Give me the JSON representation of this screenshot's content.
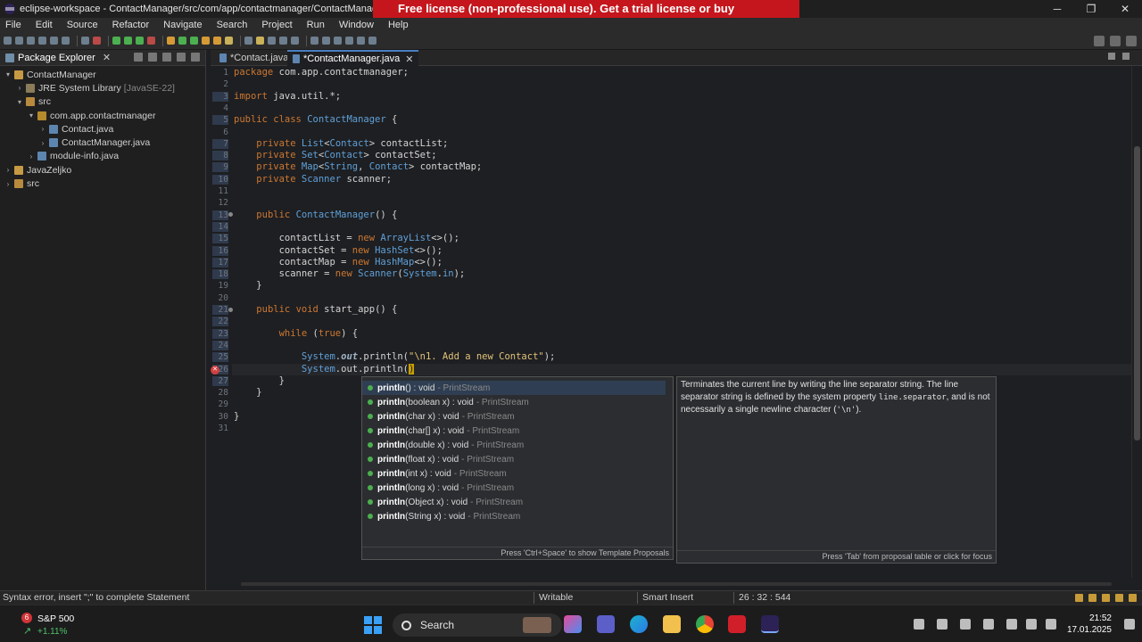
{
  "window": {
    "title": "eclipse-workspace - ContactManager/src/com/app/contactmanager/ContactManager.java - Eclipse IDE",
    "banner": "Free license (non-professional use). Get a trial license or buy",
    "minimize": "─",
    "maximize": "❐",
    "close": "✕"
  },
  "menu": [
    "File",
    "Edit",
    "Source",
    "Refactor",
    "Navigate",
    "Search",
    "Project",
    "Run",
    "Window",
    "Help"
  ],
  "package_explorer": {
    "title": "Package Explorer",
    "close": "✕",
    "tree": [
      {
        "label": "ContactManager",
        "extra": "",
        "icon": "project-icon",
        "depth": 0,
        "twisty": "▾"
      },
      {
        "label": "JRE System Library",
        "extra": "[JavaSE-22]",
        "icon": "library-icon",
        "depth": 1,
        "twisty": "›"
      },
      {
        "label": "src",
        "extra": "",
        "icon": "source-folder-icon",
        "depth": 1,
        "twisty": "▾"
      },
      {
        "label": "com.app.contactmanager",
        "extra": "",
        "icon": "package-icon",
        "depth": 2,
        "twisty": "▾"
      },
      {
        "label": "Contact.java",
        "extra": "",
        "icon": "java-file-icon",
        "depth": 3,
        "twisty": "›"
      },
      {
        "label": "ContactManager.java",
        "extra": "",
        "icon": "java-file-icon",
        "depth": 3,
        "twisty": "›"
      },
      {
        "label": "module-info.java",
        "extra": "",
        "icon": "java-file-icon",
        "depth": 2,
        "twisty": "›"
      },
      {
        "label": "JavaZeljko",
        "extra": "",
        "icon": "project-icon",
        "depth": 0,
        "twisty": "›"
      },
      {
        "label": "src",
        "extra": "",
        "icon": "source-folder-icon",
        "depth": 0,
        "twisty": "›"
      }
    ]
  },
  "editor": {
    "tabs": [
      {
        "label": "*Contact.java",
        "active": false
      },
      {
        "label": "*ContactManager.java",
        "active": true
      }
    ],
    "tab_close": "✕",
    "lines": [
      {
        "n": "1",
        "code": "package com.app.contactmanager;"
      },
      {
        "n": "2",
        "code": ""
      },
      {
        "n": "3",
        "code": "import java.util.*;"
      },
      {
        "n": "4",
        "code": ""
      },
      {
        "n": "5",
        "code": "public class ContactManager {"
      },
      {
        "n": "6",
        "code": ""
      },
      {
        "n": "7",
        "code": "    private List<Contact> contactList;"
      },
      {
        "n": "8",
        "code": "    private Set<Contact> contactSet;"
      },
      {
        "n": "9",
        "code": "    private Map<String, Contact> contactMap;"
      },
      {
        "n": "10",
        "code": "    private Scanner scanner;"
      },
      {
        "n": "11",
        "code": ""
      },
      {
        "n": "12",
        "code": ""
      },
      {
        "n": "13",
        "code": "    public ContactManager() {"
      },
      {
        "n": "14",
        "code": ""
      },
      {
        "n": "15",
        "code": "        contactList = new ArrayList<>();"
      },
      {
        "n": "16",
        "code": "        contactSet = new HashSet<>();"
      },
      {
        "n": "17",
        "code": "        contactMap = new HashMap<>();"
      },
      {
        "n": "18",
        "code": "        scanner = new Scanner(System.in);"
      },
      {
        "n": "19",
        "code": "    }"
      },
      {
        "n": "20",
        "code": ""
      },
      {
        "n": "21",
        "code": "    public void start_app() {"
      },
      {
        "n": "22",
        "code": ""
      },
      {
        "n": "23",
        "code": "        while (true) {"
      },
      {
        "n": "24",
        "code": ""
      },
      {
        "n": "25",
        "code": "            System.out.println(\"\\n1. Add a new Contact\");"
      },
      {
        "n": "26",
        "code": "            System.out.println()"
      },
      {
        "n": "27",
        "code": "        }"
      },
      {
        "n": "28",
        "code": "    }"
      },
      {
        "n": "29",
        "code": ""
      },
      {
        "n": "30",
        "code": "}"
      },
      {
        "n": "31",
        "code": ""
      }
    ]
  },
  "content_assist": {
    "proposals": [
      {
        "sig": "println() : void",
        "cls": "- PrintStream",
        "selected": true
      },
      {
        "sig": "println(boolean x) : void",
        "cls": "- PrintStream",
        "selected": false
      },
      {
        "sig": "println(char x) : void",
        "cls": "- PrintStream",
        "selected": false
      },
      {
        "sig": "println(char[] x) : void",
        "cls": "- PrintStream",
        "selected": false
      },
      {
        "sig": "println(double x) : void",
        "cls": "- PrintStream",
        "selected": false
      },
      {
        "sig": "println(float x) : void",
        "cls": "- PrintStream",
        "selected": false
      },
      {
        "sig": "println(int x) : void",
        "cls": "- PrintStream",
        "selected": false
      },
      {
        "sig": "println(long x) : void",
        "cls": "- PrintStream",
        "selected": false
      },
      {
        "sig": "println(Object x) : void",
        "cls": "- PrintStream",
        "selected": false
      },
      {
        "sig": "println(String x) : void",
        "cls": "- PrintStream",
        "selected": false
      }
    ],
    "footer": "Press 'Ctrl+Space' to show Template Proposals",
    "doc_text_1": "Terminates the current line by writing the line separator string. The line separator string is defined by the system property ",
    "doc_code_1": "line.separator",
    "doc_text_2": ", and is not necessarily a single newline character (",
    "doc_code_2": "'\\n'",
    "doc_text_3": ").",
    "doc_footer": "Press 'Tab' from proposal table or click for focus"
  },
  "status": {
    "message": "Syntax error, insert \";\" to complete Statement",
    "mode": "Writable",
    "insert": "Smart Insert",
    "position": "26 : 32 : 544"
  },
  "taskbar": {
    "stock_badge": "6",
    "stock_name": "S&P 500",
    "stock_change": "+1.11%",
    "search": "Search",
    "time": "21:52",
    "date": "17.01.2025"
  },
  "colors": {
    "banner": "#c4161c",
    "keyword": "#cc7832",
    "type": "#5fa0d8",
    "string": "#e0c27a"
  }
}
